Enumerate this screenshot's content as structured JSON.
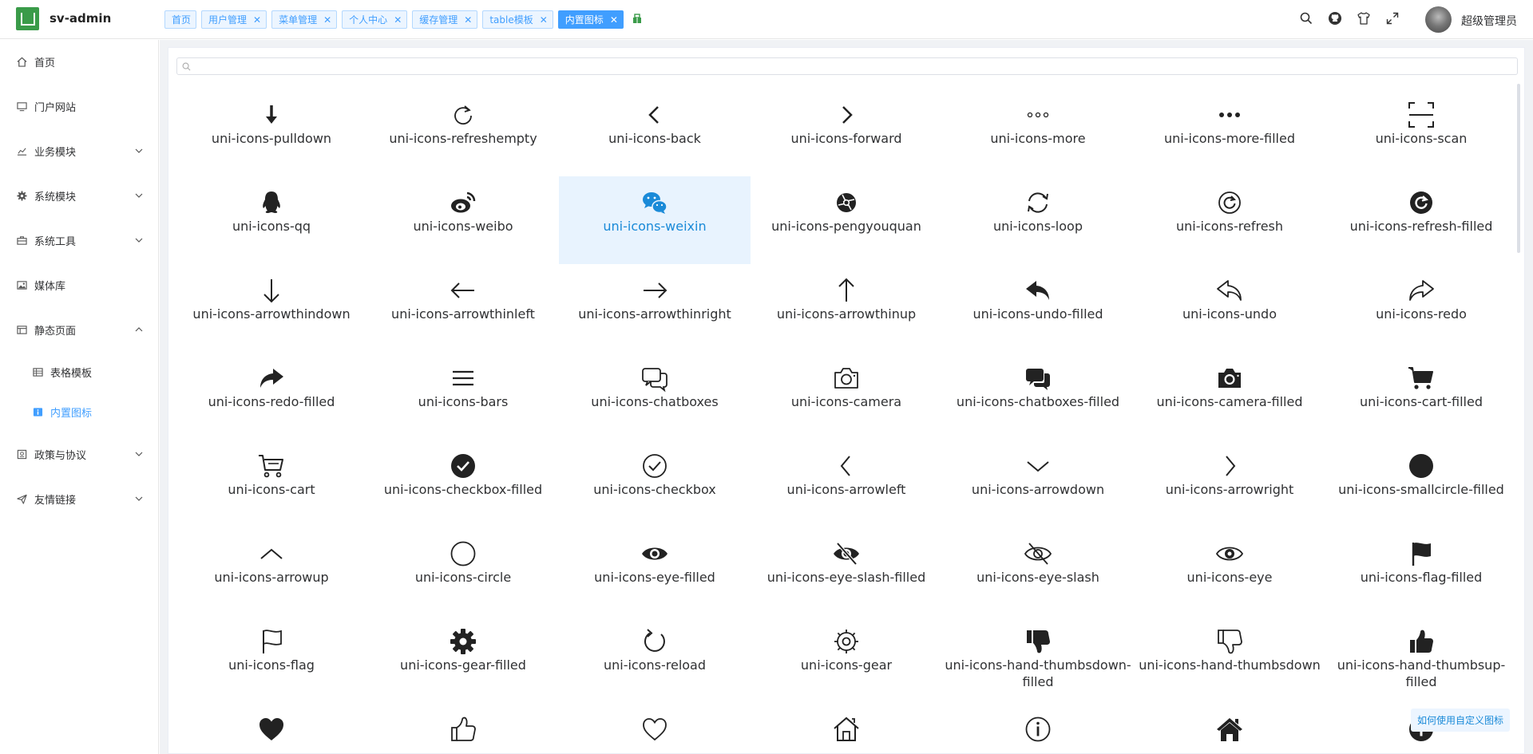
{
  "app": {
    "name": "sv-admin",
    "user": "超级管理员"
  },
  "tabs": [
    {
      "label": "首页",
      "closable": false,
      "active": false
    },
    {
      "label": "用户管理",
      "closable": true,
      "active": false
    },
    {
      "label": "菜单管理",
      "closable": true,
      "active": false
    },
    {
      "label": "个人中心",
      "closable": true,
      "active": false
    },
    {
      "label": "缓存管理",
      "closable": true,
      "active": false
    },
    {
      "label": "table模板",
      "closable": true,
      "active": false
    },
    {
      "label": "内置图标",
      "closable": true,
      "active": true
    }
  ],
  "header_icons": [
    "search-icon",
    "github-icon",
    "tshirt-icon",
    "fullscreen-icon"
  ],
  "sidebar": {
    "items": [
      {
        "label": "首页",
        "icon": "home-icon",
        "has_children": false
      },
      {
        "label": "门户网站",
        "icon": "monitor-icon",
        "has_children": false
      },
      {
        "label": "业务模块",
        "icon": "chart-icon",
        "has_children": true
      },
      {
        "label": "系统模块",
        "icon": "gear-icon",
        "has_children": true
      },
      {
        "label": "系统工具",
        "icon": "toolbox-icon",
        "has_children": true
      },
      {
        "label": "媒体库",
        "icon": "image-icon",
        "has_children": false
      },
      {
        "label": "静态页面",
        "icon": "page-icon",
        "has_children": true,
        "expanded": true
      },
      {
        "label": "表格模板",
        "icon": "table-icon",
        "sub": true
      },
      {
        "label": "内置图标",
        "icon": "info-icon",
        "sub": true,
        "active": true
      },
      {
        "label": "政策与协议",
        "icon": "document-icon",
        "has_children": true
      },
      {
        "label": "友情链接",
        "icon": "send-icon",
        "has_children": true
      }
    ]
  },
  "search": {
    "placeholder": ""
  },
  "icons": [
    "uni-icons-pulldown",
    "uni-icons-refreshempty",
    "uni-icons-back",
    "uni-icons-forward",
    "uni-icons-more",
    "uni-icons-more-filled",
    "uni-icons-scan",
    "uni-icons-qq",
    "uni-icons-weibo",
    "uni-icons-weixin",
    "uni-icons-pengyouquan",
    "uni-icons-loop",
    "uni-icons-refresh",
    "uni-icons-refresh-filled",
    "uni-icons-arrowthindown",
    "uni-icons-arrowthinleft",
    "uni-icons-arrowthinright",
    "uni-icons-arrowthinup",
    "uni-icons-undo-filled",
    "uni-icons-undo",
    "uni-icons-redo",
    "uni-icons-redo-filled",
    "uni-icons-bars",
    "uni-icons-chatboxes",
    "uni-icons-camera",
    "uni-icons-chatboxes-filled",
    "uni-icons-camera-filled",
    "uni-icons-cart-filled",
    "uni-icons-cart",
    "uni-icons-checkbox-filled",
    "uni-icons-checkbox",
    "uni-icons-arrowleft",
    "uni-icons-arrowdown",
    "uni-icons-arrowright",
    "uni-icons-smallcircle-filled",
    "uni-icons-arrowup",
    "uni-icons-circle",
    "uni-icons-eye-filled",
    "uni-icons-eye-slash-filled",
    "uni-icons-eye-slash",
    "uni-icons-eye",
    "uni-icons-flag-filled",
    "uni-icons-flag",
    "uni-icons-gear-filled",
    "uni-icons-reload",
    "uni-icons-gear",
    "uni-icons-hand-thumbsdown-filled",
    "uni-icons-hand-thumbsdown",
    "uni-icons-hand-thumbsup-filled",
    "uni-icons-heart-filled",
    "uni-icons-hand-thumbsup",
    "uni-icons-heart",
    "uni-icons-home",
    "uni-icons-info",
    "uni-icons-home-filled",
    "uni-icons-info-filled"
  ],
  "partial_row_labels_hidden": true,
  "selected_icon": "uni-icons-weixin",
  "help_link": "如何使用自定义图标",
  "colors": {
    "accent": "#409eff",
    "selected_bg": "#e8f3fe",
    "logo_green": "#3a9b49"
  }
}
